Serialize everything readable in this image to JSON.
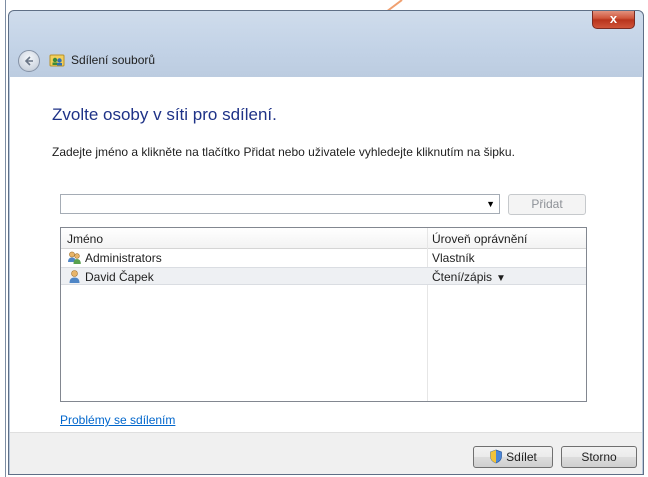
{
  "window": {
    "title": "Sdílení souborů",
    "close_label": "x"
  },
  "main": {
    "heading": "Zvolte osoby v síti pro sdílení.",
    "instruction": "Zadejte jméno a klikněte na tlačítko Přidat nebo uživatele vyhledejte kliknutím na šipku.",
    "combo_value": "",
    "add_label": "Přidat"
  },
  "table": {
    "columns": [
      "Jméno",
      "Úroveň oprávnění"
    ],
    "rows": [
      {
        "name": "Administrators",
        "permission": "Vlastník",
        "icon": "group-users-icon"
      },
      {
        "name": "David Čapek",
        "permission": "Čtení/zápis",
        "icon": "user-icon",
        "has_dropdown": true
      }
    ]
  },
  "help_link": "Problémy se sdílením",
  "footer": {
    "share_label": "Sdílet",
    "cancel_label": "Storno"
  },
  "colors": {
    "heading": "#1e3287",
    "link": "#0066cc",
    "close_button": "#c7422a",
    "selected_row": "#eef0f3"
  }
}
